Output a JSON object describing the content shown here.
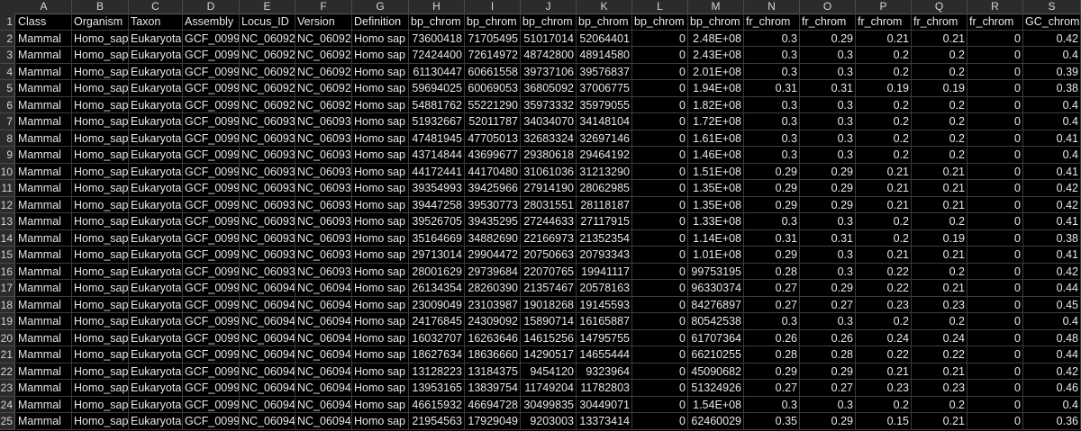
{
  "columns": [
    "A",
    "B",
    "C",
    "D",
    "E",
    "F",
    "G",
    "H",
    "I",
    "J",
    "K",
    "L",
    "M",
    "N",
    "O",
    "P",
    "Q",
    "R",
    "S"
  ],
  "rows": [
    [
      "Class",
      "Organism",
      "Taxon",
      "Assembly",
      "Locus_ID",
      "Version",
      "Definition",
      "bp_chrom",
      "bp_chrom",
      "bp_chrom",
      "bp_chrom",
      "bp_chrom",
      "bp_chrom",
      "fr_chrom",
      "fr_chrom",
      "fr_chrom",
      "fr_chrom",
      "fr_chrom",
      "GC_chrom"
    ],
    [
      "Mammal",
      "Homo_sap",
      "Eukaryota",
      "GCF_0099",
      "NC_06092",
      "NC_06092",
      "Homo sap",
      "73600418",
      "71705495",
      "51017014",
      "52064401",
      "0",
      "2.48E+08",
      "0.3",
      "0.29",
      "0.21",
      "0.21",
      "0",
      "0.42"
    ],
    [
      "Mammal",
      "Homo_sap",
      "Eukaryota",
      "GCF_0099",
      "NC_06092",
      "NC_06092",
      "Homo sap",
      "72424400",
      "72614972",
      "48742800",
      "48914580",
      "0",
      "2.43E+08",
      "0.3",
      "0.3",
      "0.2",
      "0.2",
      "0",
      "0.4"
    ],
    [
      "Mammal",
      "Homo_sap",
      "Eukaryota",
      "GCF_0099",
      "NC_06092",
      "NC_06092",
      "Homo sap",
      "61130447",
      "60661558",
      "39737106",
      "39576837",
      "0",
      "2.01E+08",
      "0.3",
      "0.3",
      "0.2",
      "0.2",
      "0",
      "0.39"
    ],
    [
      "Mammal",
      "Homo_sap",
      "Eukaryota",
      "GCF_0099",
      "NC_06092",
      "NC_06092",
      "Homo sap",
      "59694025",
      "60069053",
      "36805092",
      "37006775",
      "0",
      "1.94E+08",
      "0.31",
      "0.31",
      "0.19",
      "0.19",
      "0",
      "0.38"
    ],
    [
      "Mammal",
      "Homo_sap",
      "Eukaryota",
      "GCF_0099",
      "NC_06092",
      "NC_06092",
      "Homo sap",
      "54881762",
      "55221290",
      "35973332",
      "35979055",
      "0",
      "1.82E+08",
      "0.3",
      "0.3",
      "0.2",
      "0.2",
      "0",
      "0.4"
    ],
    [
      "Mammal",
      "Homo_sap",
      "Eukaryota",
      "GCF_0099",
      "NC_06093",
      "NC_06093",
      "Homo sap",
      "51932667",
      "52011787",
      "34034070",
      "34148104",
      "0",
      "1.72E+08",
      "0.3",
      "0.3",
      "0.2",
      "0.2",
      "0",
      "0.4"
    ],
    [
      "Mammal",
      "Homo_sap",
      "Eukaryota",
      "GCF_0099",
      "NC_06093",
      "NC_06093",
      "Homo sap",
      "47481945",
      "47705013",
      "32683324",
      "32697146",
      "0",
      "1.61E+08",
      "0.3",
      "0.3",
      "0.2",
      "0.2",
      "0",
      "0.41"
    ],
    [
      "Mammal",
      "Homo_sap",
      "Eukaryota",
      "GCF_0099",
      "NC_06093",
      "NC_06093",
      "Homo sap",
      "43714844",
      "43699677",
      "29380618",
      "29464192",
      "0",
      "1.46E+08",
      "0.3",
      "0.3",
      "0.2",
      "0.2",
      "0",
      "0.4"
    ],
    [
      "Mammal",
      "Homo_sap",
      "Eukaryota",
      "GCF_0099",
      "NC_06093",
      "NC_06093",
      "Homo sap",
      "44172441",
      "44170480",
      "31061036",
      "31213290",
      "0",
      "1.51E+08",
      "0.29",
      "0.29",
      "0.21",
      "0.21",
      "0",
      "0.41"
    ],
    [
      "Mammal",
      "Homo_sap",
      "Eukaryota",
      "GCF_0099",
      "NC_06093",
      "NC_06093",
      "Homo sap",
      "39354993",
      "39425966",
      "27914190",
      "28062985",
      "0",
      "1.35E+08",
      "0.29",
      "0.29",
      "0.21",
      "0.21",
      "0",
      "0.42"
    ],
    [
      "Mammal",
      "Homo_sap",
      "Eukaryota",
      "GCF_0099",
      "NC_06093",
      "NC_06093",
      "Homo sap",
      "39447258",
      "39530773",
      "28031551",
      "28118187",
      "0",
      "1.35E+08",
      "0.29",
      "0.29",
      "0.21",
      "0.21",
      "0",
      "0.42"
    ],
    [
      "Mammal",
      "Homo_sap",
      "Eukaryota",
      "GCF_0099",
      "NC_06093",
      "NC_06093",
      "Homo sap",
      "39526705",
      "39435295",
      "27244633",
      "27117915",
      "0",
      "1.33E+08",
      "0.3",
      "0.3",
      "0.2",
      "0.2",
      "0",
      "0.41"
    ],
    [
      "Mammal",
      "Homo_sap",
      "Eukaryota",
      "GCF_0099",
      "NC_06093",
      "NC_06093",
      "Homo sap",
      "35164669",
      "34882690",
      "22166973",
      "21352354",
      "0",
      "1.14E+08",
      "0.31",
      "0.31",
      "0.2",
      "0.19",
      "0",
      "0.38"
    ],
    [
      "Mammal",
      "Homo_sap",
      "Eukaryota",
      "GCF_0099",
      "NC_06093",
      "NC_06093",
      "Homo sap",
      "29713014",
      "29904472",
      "20750663",
      "20793343",
      "0",
      "1.01E+08",
      "0.29",
      "0.3",
      "0.21",
      "0.21",
      "0",
      "0.41"
    ],
    [
      "Mammal",
      "Homo_sap",
      "Eukaryota",
      "GCF_0099",
      "NC_06093",
      "NC_06093",
      "Homo sap",
      "28001629",
      "29739684",
      "22070765",
      "19941117",
      "0",
      "99753195",
      "0.28",
      "0.3",
      "0.22",
      "0.2",
      "0",
      "0.42"
    ],
    [
      "Mammal",
      "Homo_sap",
      "Eukaryota",
      "GCF_0099",
      "NC_06094",
      "NC_06094",
      "Homo sap",
      "26134354",
      "28260390",
      "21357467",
      "20578163",
      "0",
      "96330374",
      "0.27",
      "0.29",
      "0.22",
      "0.21",
      "0",
      "0.44"
    ],
    [
      "Mammal",
      "Homo_sap",
      "Eukaryota",
      "GCF_0099",
      "NC_06094",
      "NC_06094",
      "Homo sap",
      "23009049",
      "23103987",
      "19018268",
      "19145593",
      "0",
      "84276897",
      "0.27",
      "0.27",
      "0.23",
      "0.23",
      "0",
      "0.45"
    ],
    [
      "Mammal",
      "Homo_sap",
      "Eukaryota",
      "GCF_0099",
      "NC_06094",
      "NC_06094",
      "Homo sap",
      "24176845",
      "24309092",
      "15890714",
      "16165887",
      "0",
      "80542538",
      "0.3",
      "0.3",
      "0.2",
      "0.2",
      "0",
      "0.4"
    ],
    [
      "Mammal",
      "Homo_sap",
      "Eukaryota",
      "GCF_0099",
      "NC_06094",
      "NC_06094",
      "Homo sap",
      "16032707",
      "16263646",
      "14615256",
      "14795755",
      "0",
      "61707364",
      "0.26",
      "0.26",
      "0.24",
      "0.24",
      "0",
      "0.48"
    ],
    [
      "Mammal",
      "Homo_sap",
      "Eukaryota",
      "GCF_0099",
      "NC_06094",
      "NC_06094",
      "Homo sap",
      "18627634",
      "18636660",
      "14290517",
      "14655444",
      "0",
      "66210255",
      "0.28",
      "0.28",
      "0.22",
      "0.22",
      "0",
      "0.44"
    ],
    [
      "Mammal",
      "Homo_sap",
      "Eukaryota",
      "GCF_0099",
      "NC_06094",
      "NC_06094",
      "Homo sap",
      "13128223",
      "13184375",
      "9454120",
      "9323964",
      "0",
      "45090682",
      "0.29",
      "0.29",
      "0.21",
      "0.21",
      "0",
      "0.42"
    ],
    [
      "Mammal",
      "Homo_sap",
      "Eukaryota",
      "GCF_0099",
      "NC_06094",
      "NC_06094",
      "Homo sap",
      "13953165",
      "13839754",
      "11749204",
      "11782803",
      "0",
      "51324926",
      "0.27",
      "0.27",
      "0.23",
      "0.23",
      "0",
      "0.46"
    ],
    [
      "Mammal",
      "Homo_sap",
      "Eukaryota",
      "GCF_0099",
      "NC_06094",
      "NC_06094",
      "Homo sap",
      "46615932",
      "46694728",
      "30499835",
      "30449071",
      "0",
      "1.54E+08",
      "0.3",
      "0.3",
      "0.2",
      "0.2",
      "0",
      "0.4"
    ],
    [
      "Mammal",
      "Homo_sap",
      "Eukaryota",
      "GCF_0099",
      "NC_06094",
      "NC_06094",
      "Homo sap",
      "21954563",
      "17929049",
      "9203003",
      "13373414",
      "0",
      "62460029",
      "0.35",
      "0.29",
      "0.15",
      "0.21",
      "0",
      "0.36"
    ]
  ]
}
